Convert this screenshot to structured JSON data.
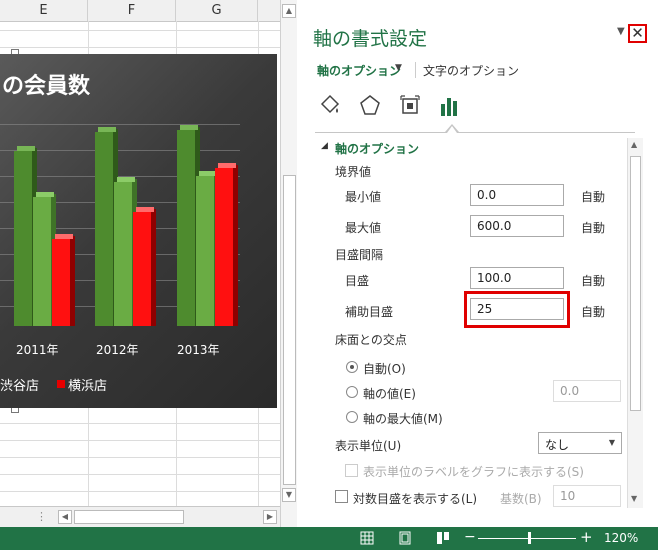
{
  "sheet": {
    "columns": [
      "E",
      "F",
      "G"
    ]
  },
  "chart": {
    "title": "の会員数",
    "years": [
      "2011年",
      "2012年",
      "2013年"
    ],
    "legend": [
      "渋谷店",
      "横浜店"
    ],
    "legend_colors": [
      "#e60000",
      "#e60000"
    ],
    "series_colors": [
      "#4f8f2f",
      "#6fb04a",
      "#ff0000"
    ]
  },
  "chart_data": {
    "type": "bar",
    "categories": [
      "2011年",
      "2012年",
      "2013年"
    ],
    "series": [
      {
        "values": [
          460,
          510,
          515
        ]
      },
      {
        "values": [
          340,
          380,
          395
        ]
      },
      {
        "name": "横浜店",
        "values": [
          230,
          300,
          415
        ]
      }
    ],
    "ylim": [
      0,
      600
    ],
    "legend_entries": [
      "渋谷店",
      "横浜店"
    ]
  },
  "pane": {
    "title": "軸の書式設定",
    "tab_axis_options": "軸のオプション",
    "tab_text_options": "文字のオプション",
    "section_title": "軸のオプション",
    "bounds_label": "境界値",
    "min_label": "最小値",
    "min_value": "0.0",
    "max_label": "最大値",
    "max_value": "600.0",
    "auto": "自動",
    "units_label": "目盛間隔",
    "major_label": "目盛",
    "major_value": "100.0",
    "minor_label": "補助目盛",
    "minor_value": "25",
    "cross_label": "床面との交点",
    "radio_auto": "自動(O)",
    "radio_axis_value": "軸の値(E)",
    "radio_axis_value_input": "0.0",
    "radio_max": "軸の最大値(M)",
    "display_units_label": "表示単位(U)",
    "display_units_value": "なし",
    "show_units_label": "表示単位のラベルをグラフに表示する(S)",
    "log_scale_label": "対数目盛を表示する(L)",
    "base_label": "基数(B)",
    "base_value": "10"
  },
  "status": {
    "zoom": "120%"
  }
}
